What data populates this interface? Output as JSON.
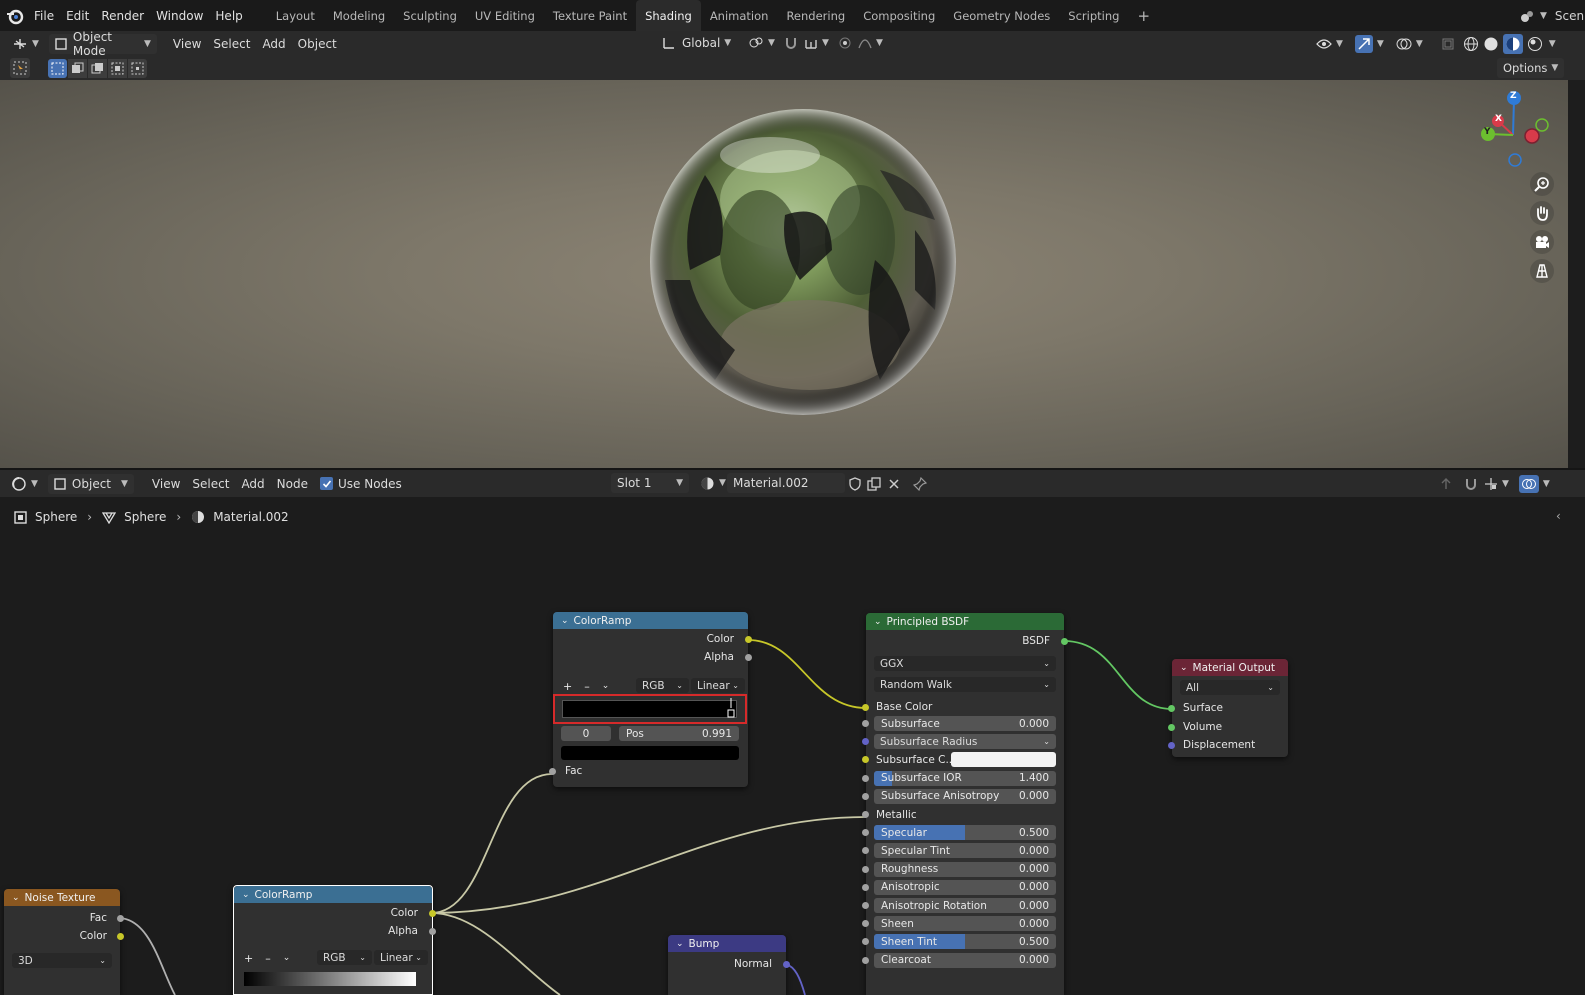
{
  "topbar": {
    "menus": [
      "File",
      "Edit",
      "Render",
      "Window",
      "Help"
    ],
    "workspaces": [
      "Layout",
      "Modeling",
      "Sculpting",
      "UV Editing",
      "Texture Paint",
      "Shading",
      "Animation",
      "Rendering",
      "Compositing",
      "Geometry Nodes",
      "Scripting"
    ],
    "active_workspace": "Shading",
    "scene_label": "Scen"
  },
  "viewport_header": {
    "mode": "Object Mode",
    "menus": [
      "View",
      "Select",
      "Add",
      "Object"
    ],
    "transform_orientation": "Global",
    "options_label": "Options"
  },
  "gizmo": {
    "z": "Z",
    "x": "X",
    "y": "Y"
  },
  "node_editor_header": {
    "editor_type": "Object",
    "menus": [
      "View",
      "Select",
      "Add",
      "Node"
    ],
    "use_nodes_label": "Use Nodes",
    "use_nodes_checked": true,
    "slot": "Slot 1",
    "material": "Material.002"
  },
  "breadcrumb": {
    "object": "Sphere",
    "mesh": "Sphere",
    "material": "Material.002"
  },
  "nodes": {
    "colorramp_main": {
      "title": "ColorRamp",
      "outputs": [
        "Color",
        "Alpha"
      ],
      "color_mode": "RGB",
      "interpolation": "Linear",
      "stop_index": "0",
      "pos_label": "Pos",
      "pos_value": "0.991",
      "input": "Fac"
    },
    "principled": {
      "title": "Principled BSDF",
      "output": "BSDF",
      "distribution": "GGX",
      "subsurface_method": "Random Walk",
      "base_color_label": "Base Color",
      "fields": [
        {
          "label": "Subsurface",
          "value": "0.000",
          "fill": 0
        },
        {
          "label": "Subsurface Radius",
          "value": "",
          "fill": 0
        },
        {
          "label": "Subsurface C...",
          "value": "",
          "fill": 0
        },
        {
          "label": "Subsurface IOR",
          "value": "1.400",
          "fill": 0.1
        },
        {
          "label": "Subsurface Anisotropy",
          "value": "0.000",
          "fill": 0
        },
        {
          "label": "Metallic",
          "value": "",
          "fill": 0
        },
        {
          "label": "Specular",
          "value": "0.500",
          "fill": 0.5
        },
        {
          "label": "Specular Tint",
          "value": "0.000",
          "fill": 0
        },
        {
          "label": "Roughness",
          "value": "0.000",
          "fill": 0
        },
        {
          "label": "Anisotropic",
          "value": "0.000",
          "fill": 0
        },
        {
          "label": "Anisotropic Rotation",
          "value": "0.000",
          "fill": 0
        },
        {
          "label": "Sheen",
          "value": "0.000",
          "fill": 0
        },
        {
          "label": "Sheen Tint",
          "value": "0.500",
          "fill": 0.5
        },
        {
          "label": "Clearcoat",
          "value": "0.000",
          "fill": 0
        }
      ]
    },
    "material_output": {
      "title": "Material Output",
      "target": "All",
      "inputs": [
        "Surface",
        "Volume",
        "Displacement"
      ]
    },
    "noise_texture": {
      "title": "Noise Texture",
      "outputs": [
        "Fac",
        "Color"
      ],
      "dimensions": "3D"
    },
    "colorramp_second": {
      "title": "ColorRamp",
      "outputs": [
        "Color",
        "Alpha"
      ],
      "color_mode": "RGB",
      "interpolation": "Linear"
    },
    "bump": {
      "title": "Bump",
      "output": "Normal"
    }
  },
  "colors": {
    "converter_header": "#3b6f93",
    "shader_header": "#2b6a36",
    "output_header": "#6b2536",
    "texture_header": "#8a5720",
    "vector_header": "#3c3a83",
    "socket_color": "#c7c729",
    "socket_gray": "#a1a1a1",
    "socket_shader": "#63c763",
    "socket_vector": "#6363c7",
    "highlight_box": "#d62a2a",
    "field_fill": "#4772b3"
  }
}
